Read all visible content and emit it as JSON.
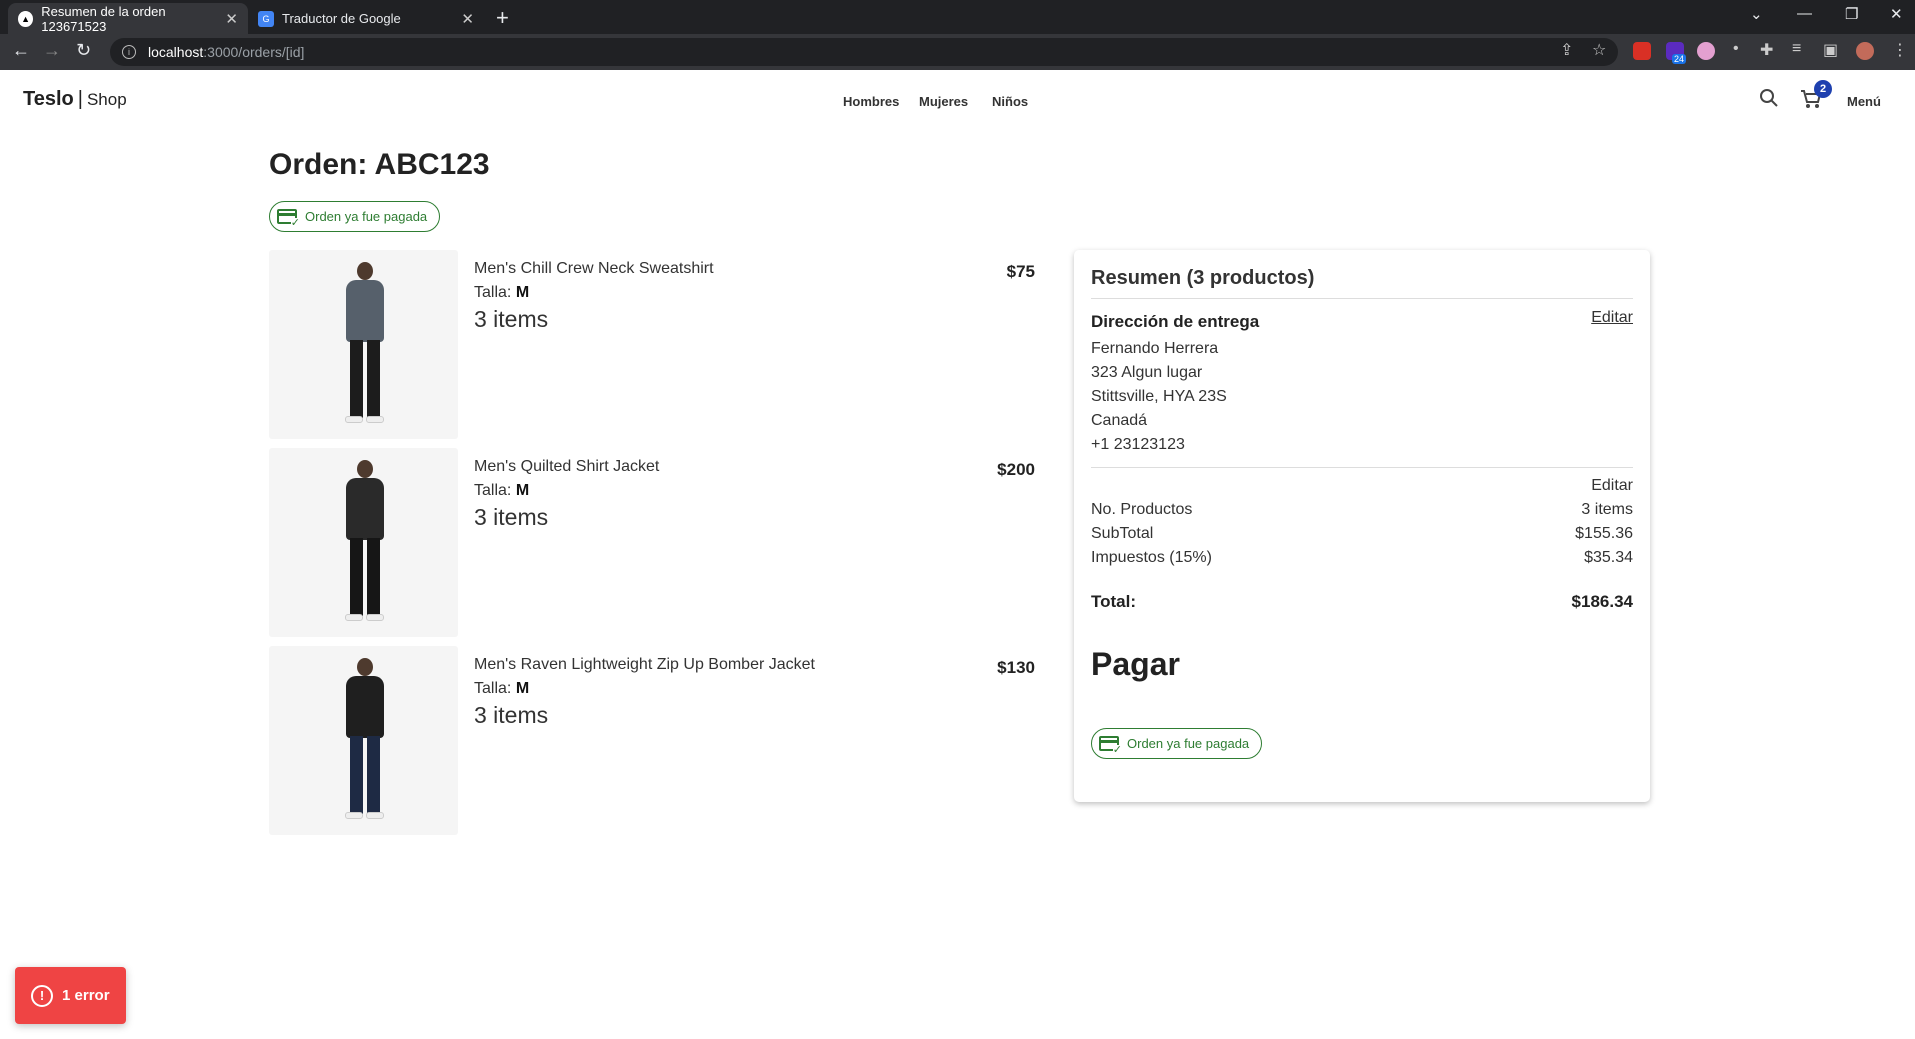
{
  "browser": {
    "tabs": [
      {
        "title": "Resumen de la orden 123671523",
        "active": true
      },
      {
        "title": "Traductor de Google",
        "active": false
      }
    ],
    "url_host": "localhost",
    "url_path": ":3000/orders/[id]",
    "extension_badge": "24"
  },
  "header": {
    "brand": "Teslo",
    "brand_sep": "|",
    "brand_sub": "Shop",
    "nav": [
      "Hombres",
      "Mujeres",
      "Niños"
    ],
    "cart_count": "2",
    "menu_label": "Menú"
  },
  "order": {
    "title": "Orden: ABC123",
    "paid_chip_label": "Orden ya fue pagada"
  },
  "products": [
    {
      "name": "Men's Chill Crew Neck Sweatshirt",
      "size_label": "Talla:",
      "size": "M",
      "qty": "3 items",
      "price": "$75",
      "shirt_color": "#56606b",
      "pants_color": "#1c1c1c"
    },
    {
      "name": "Men's Quilted Shirt Jacket",
      "size_label": "Talla:",
      "size": "M",
      "qty": "3 items",
      "price": "$200",
      "shirt_color": "#2a2a2a",
      "pants_color": "#161616"
    },
    {
      "name": "Men's Raven Lightweight Zip Up Bomber Jacket",
      "size_label": "Talla:",
      "size": "M",
      "qty": "3 items",
      "price": "$130",
      "shirt_color": "#1f1f1f",
      "pants_color": "#1e2a44"
    }
  ],
  "summary": {
    "title": "Resumen (3 productos)",
    "delivery_heading": "Dirección de entrega",
    "edit_label": "Editar",
    "address": [
      "Fernando Herrera",
      "323 Algun lugar",
      "Stittsville, HYA 23S",
      "Canadá",
      "+1 23123123"
    ],
    "rows": [
      {
        "label": "No. Productos",
        "value": "3 items"
      },
      {
        "label": "SubTotal",
        "value": "$155.36"
      },
      {
        "label": "Impuestos (15%)",
        "value": "$35.34"
      }
    ],
    "total_label": "Total:",
    "total_value": "$186.34",
    "pay_label": "Pagar",
    "paid_chip_label": "Orden ya fue pagada"
  },
  "error_toast": {
    "label": "1 error"
  },
  "colors": {
    "paid_green": "#2e7d32",
    "error_red": "#ef4444",
    "badge_blue": "#1e40af"
  }
}
